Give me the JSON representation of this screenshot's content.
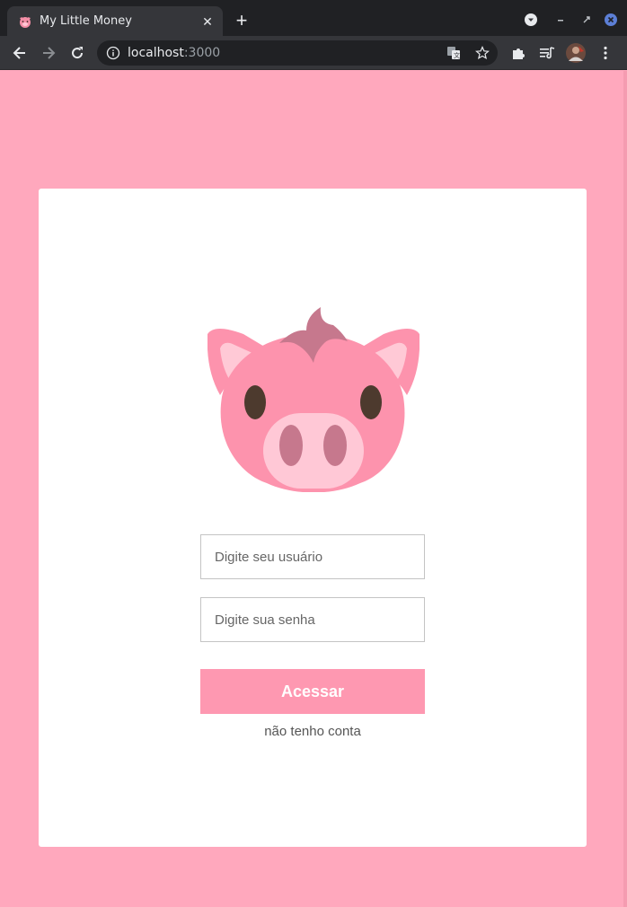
{
  "browser": {
    "tab_title": "My Little Money",
    "url_host": "localhost",
    "url_port": ":3000"
  },
  "login": {
    "username_placeholder": "Digite seu usuário",
    "password_placeholder": "Digite sua senha",
    "submit_label": "Acessar",
    "no_account_link": "não tenho conta"
  },
  "colors": {
    "background": "#ffa8bd",
    "button": "#fe98b1",
    "card": "#ffffff"
  },
  "icons": {
    "favicon": "pig-face-icon",
    "logo": "pig-face-icon"
  }
}
